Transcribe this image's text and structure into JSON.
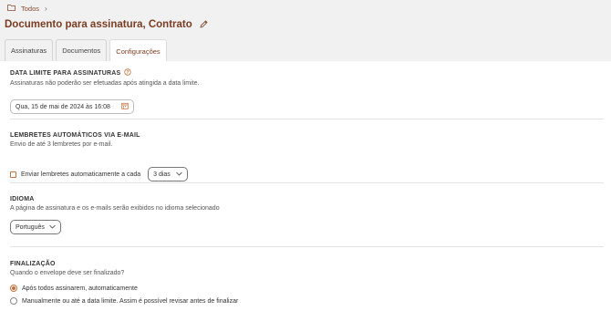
{
  "breadcrumb": {
    "root_label": "Todos"
  },
  "page": {
    "title": "Documento para assinatura, Contrato"
  },
  "tabs": [
    {
      "label": "Assinaturas",
      "active": false
    },
    {
      "label": "Documentos",
      "active": false
    },
    {
      "label": "Configurações",
      "active": true
    }
  ],
  "deadline": {
    "heading": "DATA LIMITE PARA ASSINATURAS",
    "description": "Assinaturas não poderão ser efetuadas após atingida a data limite.",
    "value": "Qua, 15 de mai de 2024 às 16:08"
  },
  "reminders": {
    "heading": "LEMBRETES AUTOMÁTICOS VIA E-MAIL",
    "description": "Envio de até 3 lembretes por e-mail.",
    "checkbox_label": "Enviar lembretes automaticamente a cada",
    "checked": false,
    "interval": "3 dias"
  },
  "language": {
    "heading": "IDIOMA",
    "description": "A página de assinatura e os e-mails serão exibidos no idioma selecionado",
    "value": "Português"
  },
  "finalization": {
    "heading": "FINALIZAÇÃO",
    "description": "Quando o envelope deve ser finalizado?",
    "options": [
      {
        "label": "Após todos assinarem, automaticamente",
        "selected": true
      },
      {
        "label": "Manualmente ou até a data limite. Assim é possível revisar antes de finalizar",
        "selected": false
      }
    ]
  },
  "colors": {
    "accent": "#c4723e",
    "title": "#7a3d22",
    "background": "#f1f1f1",
    "panel": "#ffffff"
  },
  "icons": [
    "folder-icon",
    "chevron-right-icon",
    "pencil-icon",
    "info-icon",
    "calendar-icon",
    "chevron-down-icon"
  ]
}
